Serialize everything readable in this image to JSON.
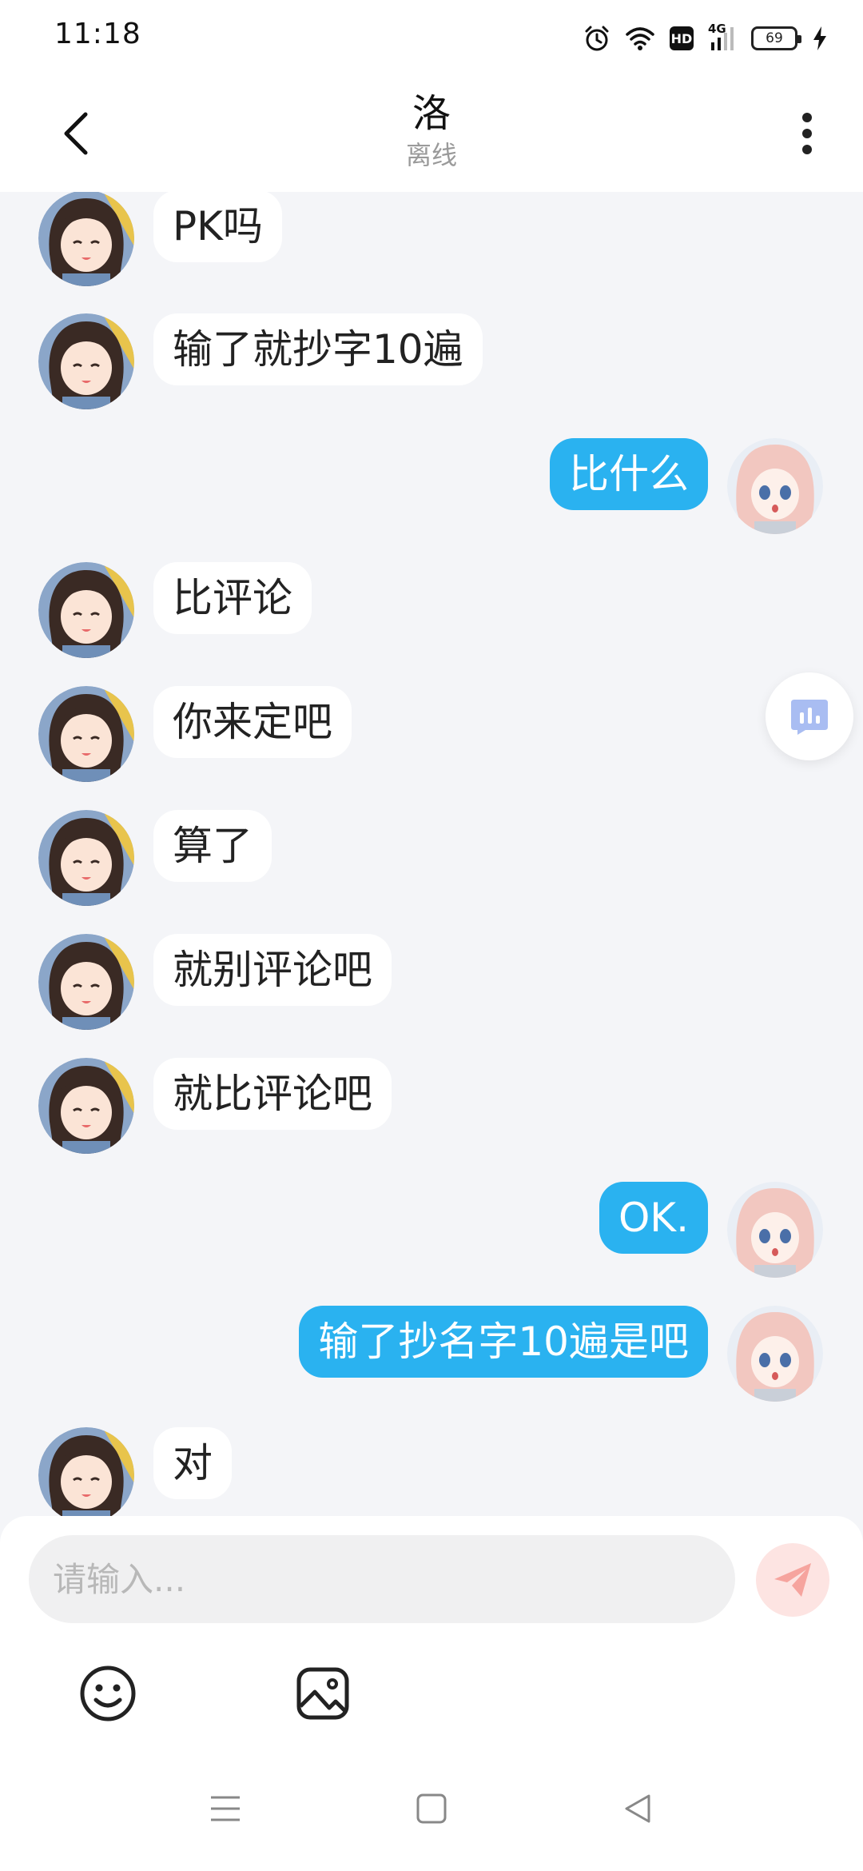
{
  "status_bar": {
    "time": "11:18",
    "network_label": "4G",
    "hd_label": "HD",
    "battery_level": "69"
  },
  "header": {
    "title": "洛",
    "subtitle": "离线"
  },
  "messages": [
    {
      "side": "left",
      "text": "PK吗"
    },
    {
      "side": "left",
      "text": "输了就抄字10遍"
    },
    {
      "side": "right",
      "text": "比什么"
    },
    {
      "side": "left",
      "text": "比评论"
    },
    {
      "side": "left",
      "text": "你来定吧"
    },
    {
      "side": "left",
      "text": "算了"
    },
    {
      "side": "left",
      "text": "就别评论吧"
    },
    {
      "side": "left",
      "text": "就比评论吧"
    },
    {
      "side": "right",
      "text": "OK."
    },
    {
      "side": "right",
      "text": "输了抄名字10遍是吧"
    },
    {
      "side": "left",
      "text": "对"
    }
  ],
  "input": {
    "placeholder": "请输入..."
  },
  "colors": {
    "sent_bubble": "#2ab2f0",
    "received_bubble": "#ffffff",
    "send_button_bg": "#fde4e2",
    "send_button_icon": "#f6a49e",
    "float_button_icon": "#a9bdf2",
    "background": "#f4f5f8"
  },
  "icons": {
    "back": "chevron-left-icon",
    "more": "more-vertical-icon",
    "float": "bar-chart-icon",
    "send": "paper-plane-icon",
    "emoji": "smiley-icon",
    "image": "image-icon",
    "nav_menu": "menu-icon",
    "nav_home": "square-icon",
    "nav_back": "triangle-back-icon"
  }
}
